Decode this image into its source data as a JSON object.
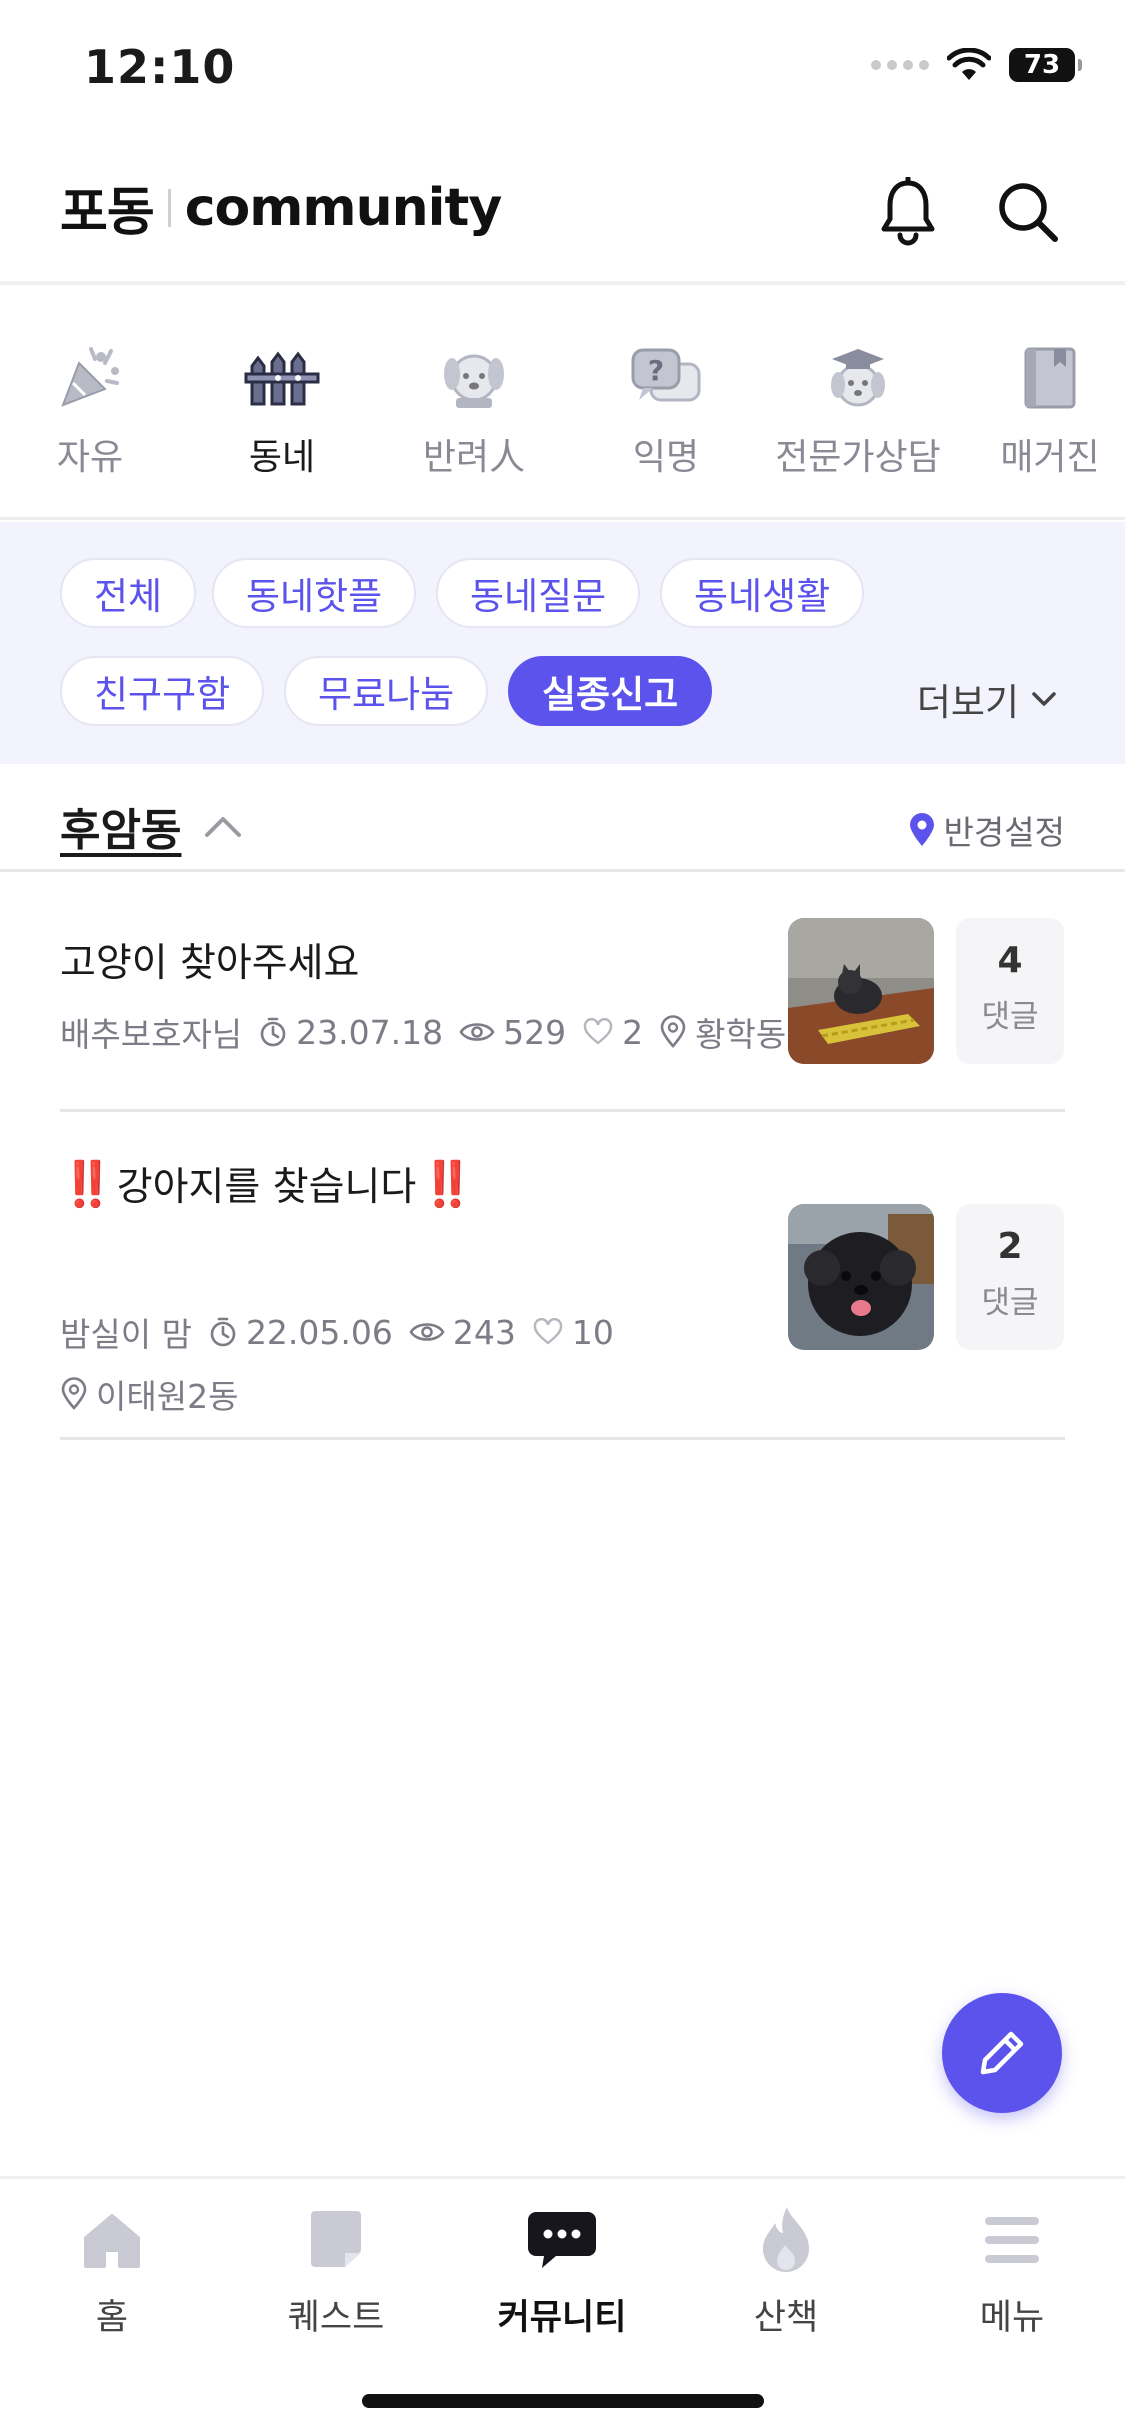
{
  "status_bar": {
    "time": "12:10",
    "battery": "73"
  },
  "header": {
    "logo_ko": "포동",
    "logo_en": "community"
  },
  "categories": [
    {
      "label": "자유",
      "icon": "party-popper-icon"
    },
    {
      "label": "동네",
      "icon": "fence-icon"
    },
    {
      "label": "반려人",
      "icon": "dog-icon"
    },
    {
      "label": "익명",
      "icon": "question-bubble-icon"
    },
    {
      "label": "전문가상담",
      "icon": "graduate-dog-icon"
    },
    {
      "label": "매거진",
      "icon": "book-icon"
    }
  ],
  "active_category": "동네",
  "filters": {
    "chips": [
      "전체",
      "동네핫플",
      "동네질문",
      "동네생활",
      "친구구함",
      "무료나눔",
      "실종신고"
    ],
    "active": "실종신고",
    "more_label": "더보기"
  },
  "location": {
    "name": "후암동",
    "radius_label": "반경설정"
  },
  "posts": [
    {
      "title": "고양이 찾아주세요",
      "author": "배추보호자님",
      "date": "23.07.18",
      "views": "529",
      "likes": "2",
      "place": "황학동",
      "comments": "4",
      "comments_label": "댓글"
    },
    {
      "title_prefix": "‼️",
      "title": "강아지를 찾습니다",
      "title_suffix": "‼️",
      "author": "밤실이 맘",
      "date": "22.05.06",
      "views": "243",
      "likes": "10",
      "place": "이태원2동",
      "comments": "2",
      "comments_label": "댓글"
    }
  ],
  "bottom_nav": [
    {
      "label": "홈",
      "icon": "home-icon"
    },
    {
      "label": "퀘스트",
      "icon": "note-icon"
    },
    {
      "label": "커뮤니티",
      "icon": "chat-bubble-icon"
    },
    {
      "label": "산책",
      "icon": "flame-icon"
    },
    {
      "label": "메뉴",
      "icon": "menu-icon"
    }
  ],
  "active_nav": "커뮤니티",
  "colors": {
    "accent": "#5b53ec",
    "chip_bg": "#f3f3fd",
    "alert_red": "#e5332a"
  }
}
